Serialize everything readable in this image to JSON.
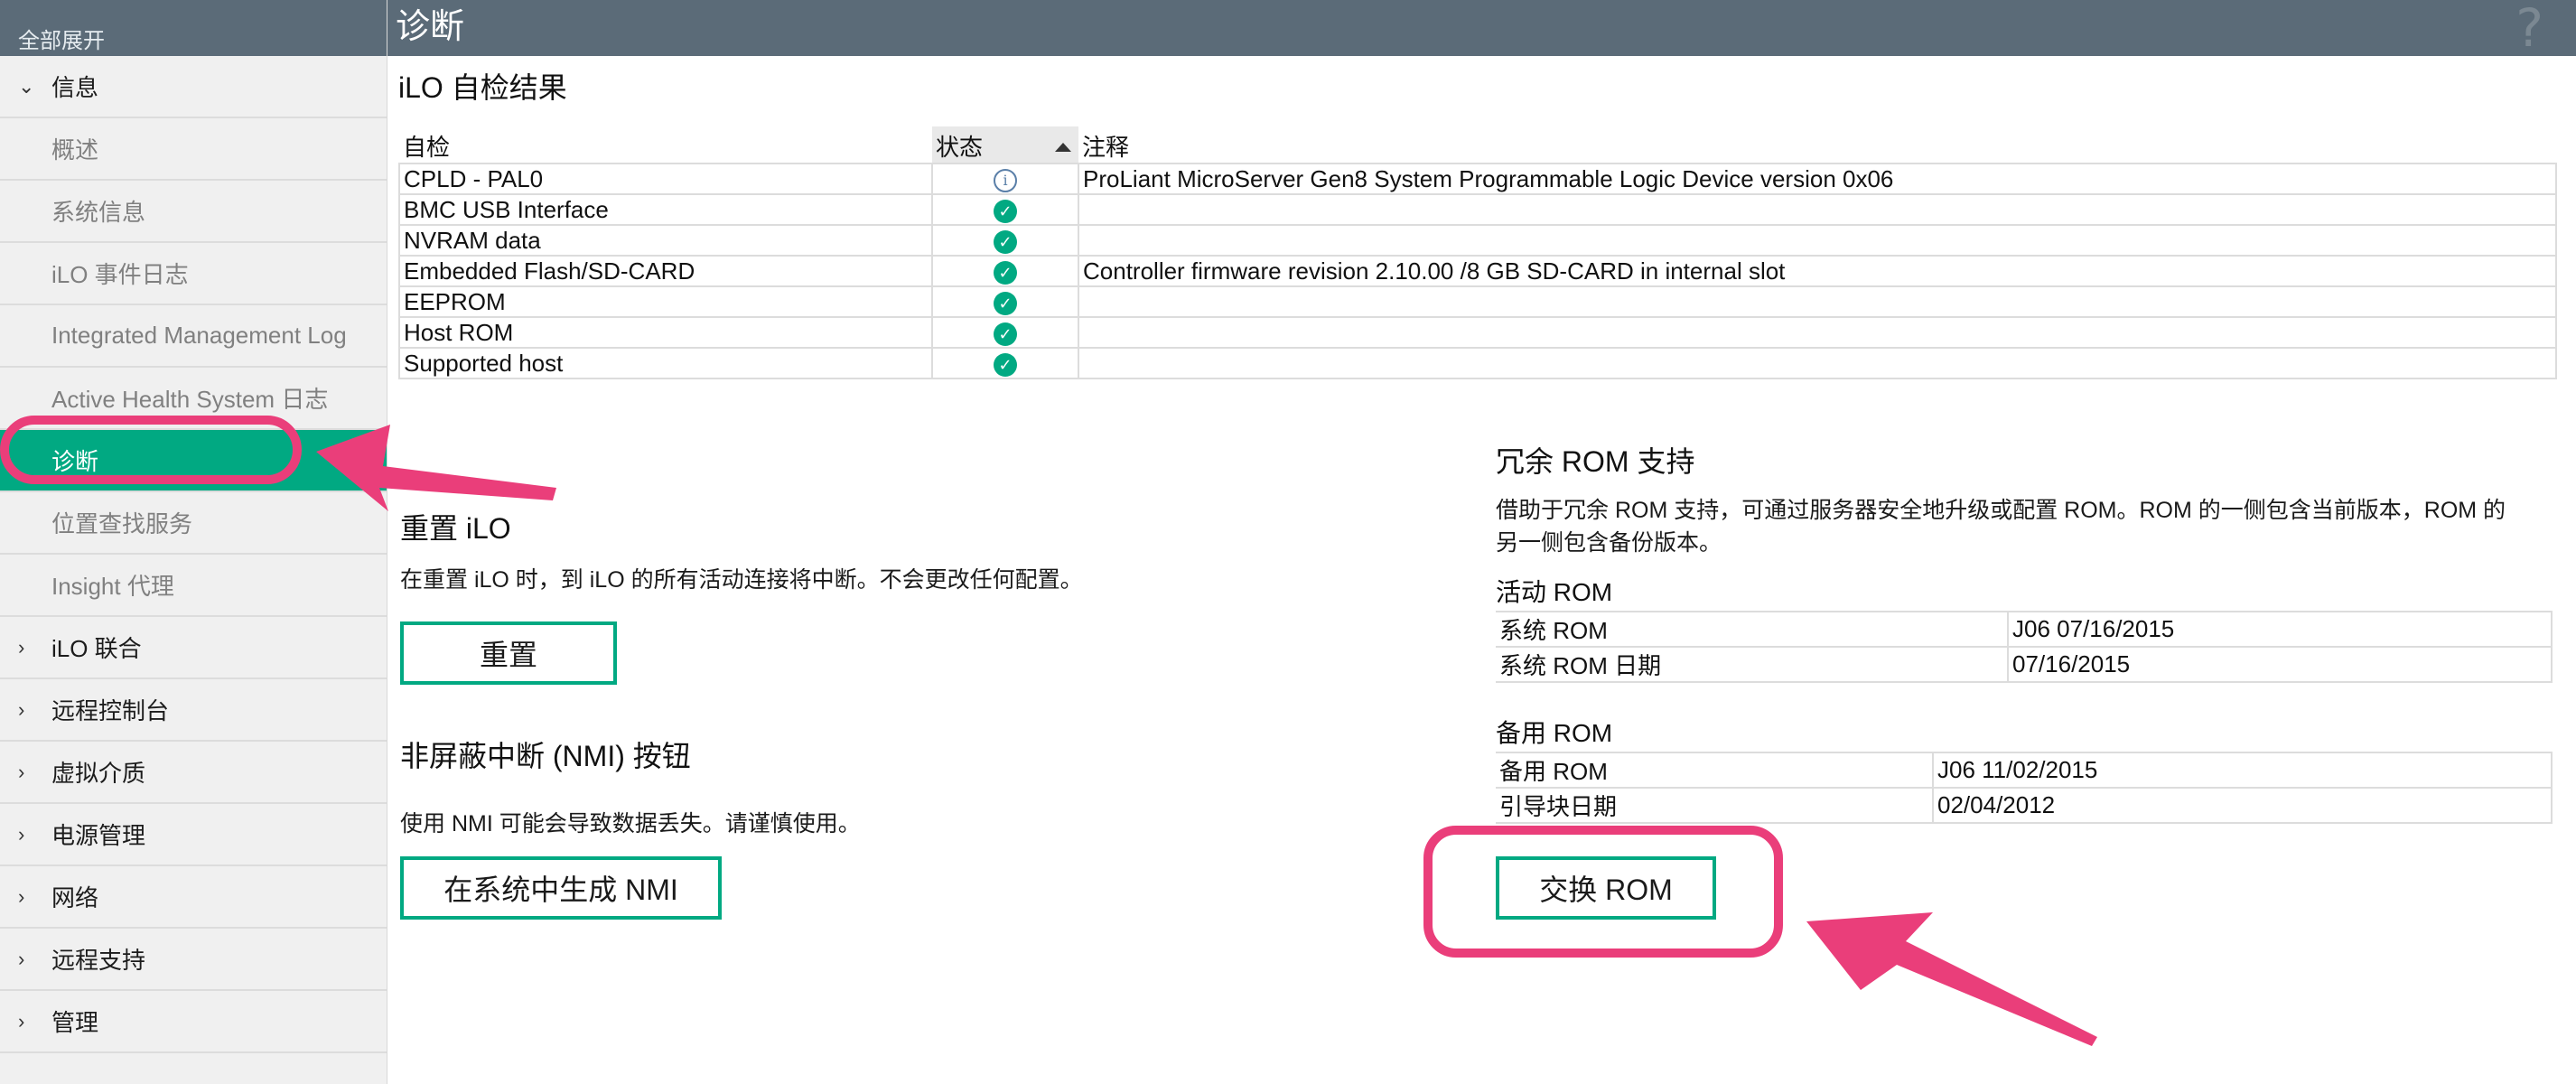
{
  "sidebar": {
    "expand_all": "全部展开",
    "items": [
      {
        "label": "信息",
        "level": "top",
        "expanded": true
      },
      {
        "label": "概述",
        "level": "sub"
      },
      {
        "label": "系统信息",
        "level": "sub"
      },
      {
        "label": "iLO 事件日志",
        "level": "sub"
      },
      {
        "label": "Integrated Management Log",
        "level": "sub"
      },
      {
        "label": "Active Health System 日志",
        "level": "sub"
      },
      {
        "label": "诊断",
        "level": "sub",
        "active": true
      },
      {
        "label": "位置查找服务",
        "level": "sub"
      },
      {
        "label": "Insight 代理",
        "level": "sub"
      },
      {
        "label": "iLO 联合",
        "level": "top"
      },
      {
        "label": "远程控制台",
        "level": "top"
      },
      {
        "label": "虚拟介质",
        "level": "top"
      },
      {
        "label": "电源管理",
        "level": "top"
      },
      {
        "label": "网络",
        "level": "top"
      },
      {
        "label": "远程支持",
        "level": "top"
      },
      {
        "label": "管理",
        "level": "top"
      }
    ]
  },
  "header": {
    "title": "诊断",
    "help": "?"
  },
  "selftest": {
    "title": "iLO 自检结果",
    "columns": [
      "自检",
      "状态",
      "注释"
    ],
    "rows": [
      {
        "name": "CPLD - PAL0",
        "status": "info",
        "note": "ProLiant MicroServer Gen8 System Programmable Logic Device version 0x06"
      },
      {
        "name": "BMC USB Interface",
        "status": "ok",
        "note": ""
      },
      {
        "name": "NVRAM data",
        "status": "ok",
        "note": ""
      },
      {
        "name": "Embedded Flash/SD-CARD",
        "status": "ok",
        "note": "Controller firmware revision 2.10.00 /8 GB SD-CARD in internal slot"
      },
      {
        "name": "EEPROM",
        "status": "ok",
        "note": ""
      },
      {
        "name": "Host ROM",
        "status": "ok",
        "note": ""
      },
      {
        "name": "Supported host",
        "status": "ok",
        "note": ""
      }
    ]
  },
  "reset": {
    "title": "重置 iLO",
    "text": "在重置 iLO 时，到 iLO 的所有活动连接将中断。不会更改任何配置。",
    "button": "重置"
  },
  "nmi": {
    "title": "非屏蔽中断 (NMI) 按钮",
    "text": "使用 NMI 可能会导致数据丢失。请谨慎使用。",
    "button": "在系统中生成 NMI"
  },
  "rom": {
    "title": "冗余 ROM 支持",
    "text_line1": "借助于冗余 ROM 支持，可通过服务器安全地升级或配置 ROM。ROM 的一侧包含当前版本，ROM 的",
    "text_line2": "另一侧包含备份版本。",
    "active_title": "活动 ROM",
    "active": [
      {
        "key": "系统 ROM",
        "value": "J06 07/16/2015"
      },
      {
        "key": "系统 ROM 日期",
        "value": "07/16/2015"
      }
    ],
    "backup_title": "备用 ROM",
    "backup": [
      {
        "key": "备用 ROM",
        "value": "J06 11/02/2015"
      },
      {
        "key": "引导块日期",
        "value": "02/04/2012"
      }
    ],
    "swap_button": "交换 ROM"
  },
  "colors": {
    "accent": "#01a982",
    "header_bg": "#5b6b78",
    "annotation": "#ea3e7a"
  }
}
